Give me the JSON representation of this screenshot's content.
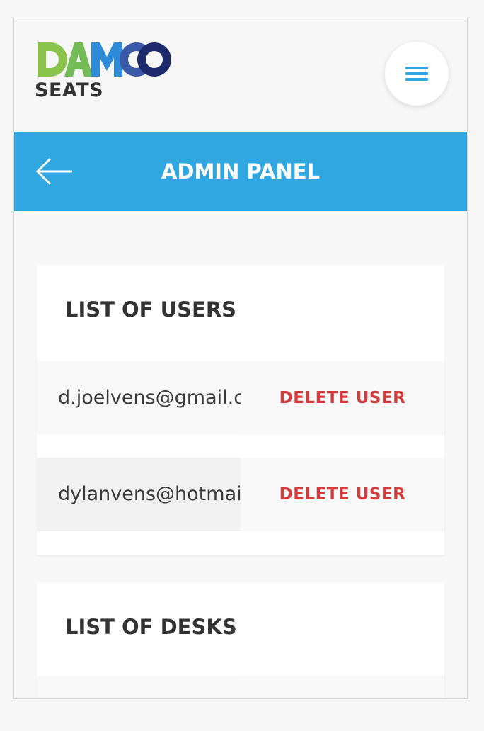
{
  "brand": {
    "logo_text": "DAMCO",
    "sub_label": "SEATS",
    "colors": [
      "#8bc34a",
      "#2f8bd8",
      "#3a5aa8",
      "#1d2a6b"
    ]
  },
  "header": {
    "menu_icon": "hamburger-icon",
    "accent": "#31a7e2"
  },
  "titlebar": {
    "back_icon": "arrow-left-icon",
    "title": "ADMIN PANEL"
  },
  "users_section": {
    "title": "LIST OF USERS",
    "users": [
      {
        "email": "d.joelvens@gmail.com",
        "action": "DELETE USER"
      },
      {
        "email": "dylanvens@hotmail.com",
        "action": "DELETE USER"
      }
    ]
  },
  "desks_section": {
    "title": "LIST OF DESKS"
  }
}
